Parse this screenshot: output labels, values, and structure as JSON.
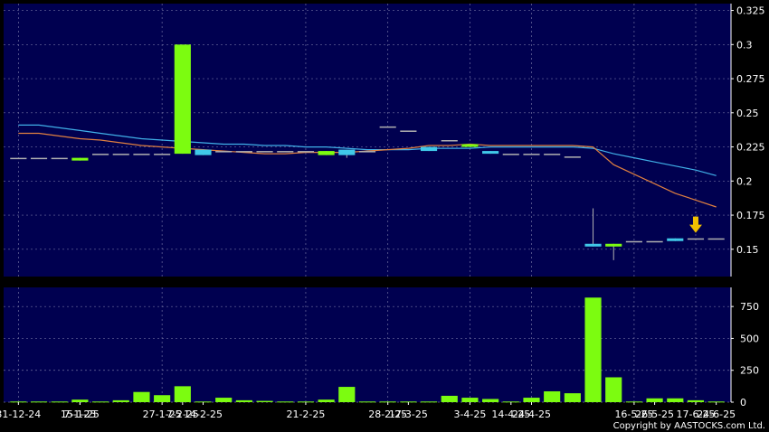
{
  "chart_data": [
    {
      "type": "candlestick",
      "panel": "price",
      "ylim": [
        0.13,
        0.33
      ],
      "yticks": [
        0.15,
        0.175,
        0.2,
        0.225,
        0.25,
        0.275,
        0.3,
        0.325
      ],
      "grid": true,
      "candles": [
        {
          "o": 0.217,
          "h": 0.217,
          "l": 0.217,
          "c": 0.217
        },
        {
          "o": 0.217,
          "h": 0.217,
          "l": 0.217,
          "c": 0.217
        },
        {
          "o": 0.217,
          "h": 0.217,
          "l": 0.217,
          "c": 0.217
        },
        {
          "o": 0.215,
          "h": 0.217,
          "l": 0.215,
          "c": 0.217
        },
        {
          "o": 0.22,
          "h": 0.22,
          "l": 0.22,
          "c": 0.22
        },
        {
          "o": 0.22,
          "h": 0.22,
          "l": 0.22,
          "c": 0.22
        },
        {
          "o": 0.22,
          "h": 0.22,
          "l": 0.22,
          "c": 0.22
        },
        {
          "o": 0.22,
          "h": 0.22,
          "l": 0.22,
          "c": 0.22
        },
        {
          "o": 0.22,
          "h": 0.3,
          "l": 0.22,
          "c": 0.3
        },
        {
          "o": 0.223,
          "h": 0.223,
          "l": 0.219,
          "c": 0.219
        },
        {
          "o": 0.222,
          "h": 0.222,
          "l": 0.222,
          "c": 0.222
        },
        {
          "o": 0.222,
          "h": 0.222,
          "l": 0.222,
          "c": 0.222
        },
        {
          "o": 0.222,
          "h": 0.222,
          "l": 0.222,
          "c": 0.222
        },
        {
          "o": 0.222,
          "h": 0.222,
          "l": 0.222,
          "c": 0.222
        },
        {
          "o": 0.222,
          "h": 0.222,
          "l": 0.222,
          "c": 0.222
        },
        {
          "o": 0.219,
          "h": 0.222,
          "l": 0.219,
          "c": 0.222
        },
        {
          "o": 0.223,
          "h": 0.223,
          "l": 0.217,
          "c": 0.219
        },
        {
          "o": 0.222,
          "h": 0.222,
          "l": 0.222,
          "c": 0.222
        },
        {
          "o": 0.24,
          "h": 0.24,
          "l": 0.24,
          "c": 0.24
        },
        {
          "o": 0.237,
          "h": 0.237,
          "l": 0.237,
          "c": 0.237
        },
        {
          "o": 0.225,
          "h": 0.225,
          "l": 0.222,
          "c": 0.222
        },
        {
          "o": 0.23,
          "h": 0.23,
          "l": 0.23,
          "c": 0.23
        },
        {
          "o": 0.225,
          "h": 0.227,
          "l": 0.225,
          "c": 0.227
        },
        {
          "o": 0.222,
          "h": 0.222,
          "l": 0.22,
          "c": 0.22
        },
        {
          "o": 0.22,
          "h": 0.22,
          "l": 0.22,
          "c": 0.22
        },
        {
          "o": 0.22,
          "h": 0.22,
          "l": 0.22,
          "c": 0.22
        },
        {
          "o": 0.22,
          "h": 0.22,
          "l": 0.22,
          "c": 0.22
        },
        {
          "o": 0.218,
          "h": 0.218,
          "l": 0.218,
          "c": 0.218
        },
        {
          "o": 0.154,
          "h": 0.18,
          "l": 0.152,
          "c": 0.152
        },
        {
          "o": 0.152,
          "h": 0.154,
          "l": 0.142,
          "c": 0.154
        },
        {
          "o": 0.156,
          "h": 0.156,
          "l": 0.156,
          "c": 0.156
        },
        {
          "o": 0.156,
          "h": 0.156,
          "l": 0.156,
          "c": 0.156
        },
        {
          "o": 0.158,
          "h": 0.158,
          "l": 0.156,
          "c": 0.156
        },
        {
          "o": 0.158,
          "h": 0.158,
          "l": 0.158,
          "c": 0.158
        },
        {
          "o": 0.158,
          "h": 0.158,
          "l": 0.158,
          "c": 0.158
        }
      ],
      "ma_short": [
        0.235,
        0.235,
        0.233,
        0.231,
        0.23,
        0.228,
        0.226,
        0.225,
        0.224,
        0.223,
        0.222,
        0.221,
        0.22,
        0.22,
        0.221,
        0.221,
        0.221,
        0.222,
        0.223,
        0.224,
        0.226,
        0.226,
        0.227,
        0.226,
        0.226,
        0.226,
        0.226,
        0.226,
        0.225,
        0.212,
        0.205,
        0.198,
        0.191,
        0.186,
        0.181
      ],
      "ma_long": [
        0.241,
        0.241,
        0.239,
        0.237,
        0.235,
        0.233,
        0.231,
        0.23,
        0.229,
        0.228,
        0.227,
        0.227,
        0.226,
        0.226,
        0.225,
        0.225,
        0.224,
        0.223,
        0.223,
        0.223,
        0.224,
        0.224,
        0.224,
        0.225,
        0.225,
        0.225,
        0.225,
        0.225,
        0.224,
        0.22,
        0.217,
        0.214,
        0.211,
        0.208,
        0.204
      ],
      "marker": {
        "index": 33,
        "value": 0.166
      }
    },
    {
      "type": "bar",
      "panel": "volume",
      "ylim": [
        0,
        900
      ],
      "yticks": [
        0,
        250,
        500,
        750
      ],
      "grid": true,
      "values": [
        5,
        5,
        5,
        20,
        5,
        15,
        80,
        55,
        125,
        5,
        35,
        15,
        10,
        5,
        5,
        20,
        120,
        5,
        5,
        5,
        5,
        50,
        35,
        25,
        5,
        35,
        85,
        70,
        820,
        195,
        5,
        30,
        30,
        15,
        5
      ]
    }
  ],
  "x_labels": [
    {
      "index": 0,
      "text": "31-12-24"
    },
    {
      "index": 3,
      "text": "7-1-25"
    },
    {
      "index": 3,
      "text": "15-1-25"
    },
    {
      "index": 7,
      "text": "27-1-25"
    },
    {
      "index": 8,
      "text": "7-2-25"
    },
    {
      "index": 9,
      "text": "14-2-25"
    },
    {
      "index": 14,
      "text": "21-2-25"
    },
    {
      "index": 18,
      "text": "28-2-25"
    },
    {
      "index": 19,
      "text": "17-3-25"
    },
    {
      "index": 22,
      "text": "3-4-25"
    },
    {
      "index": 24,
      "text": "14-4-25"
    },
    {
      "index": 25,
      "text": "24-4-25"
    },
    {
      "index": 30,
      "text": "16-5-25"
    },
    {
      "index": 31,
      "text": "26-5-25"
    },
    {
      "index": 33,
      "text": "17-6-25"
    },
    {
      "index": 34,
      "text": "24-6-25"
    }
  ],
  "colors": {
    "background": "#000000",
    "panel": "#000050",
    "grid": "#6f6fa0",
    "up": "#7cfc10",
    "down": "#40c8e8",
    "flat": "#b0b0b0",
    "ma_short": "#e08040",
    "ma_long": "#40b0e8",
    "arrow": "#f0c000",
    "text": "#ffffff"
  },
  "copyright": "Copyright by AASTOCKS.com Ltd."
}
